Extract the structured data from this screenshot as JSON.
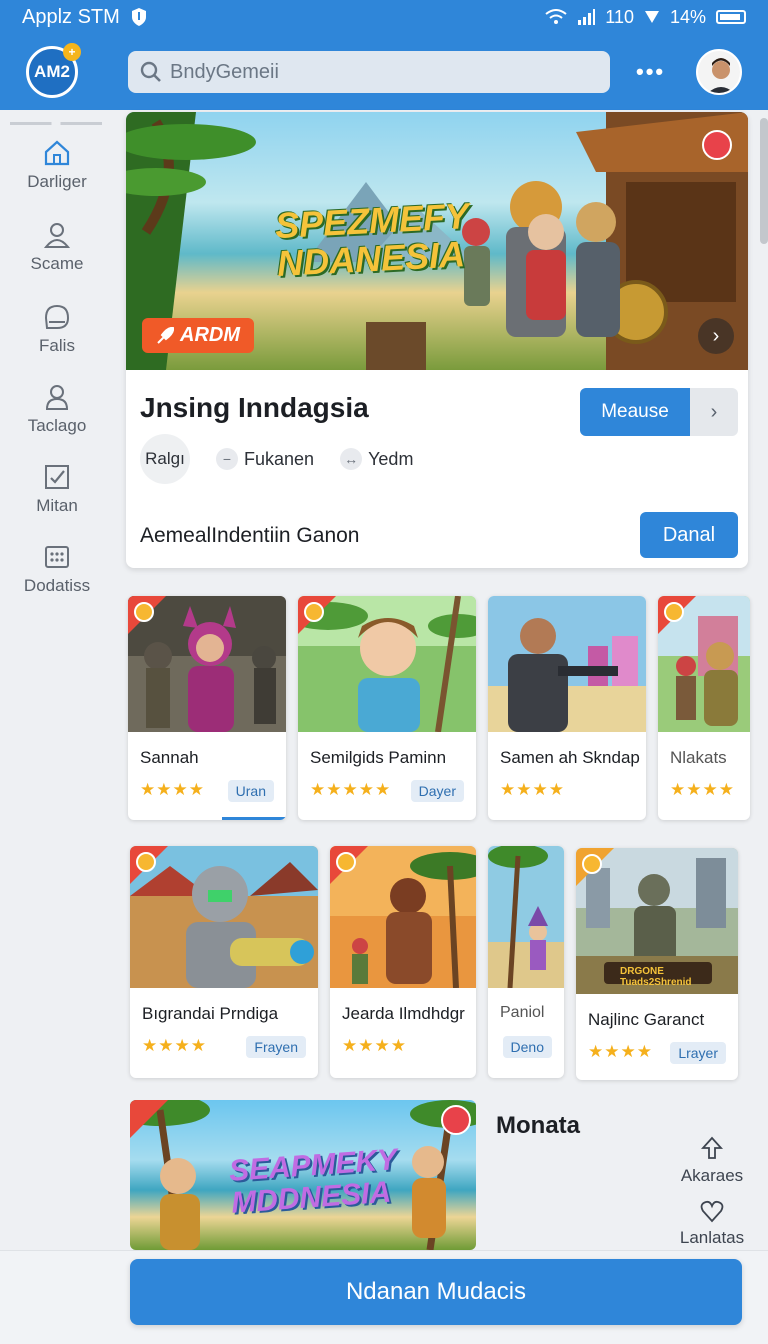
{
  "status_bar": {
    "app_name": "Applz STM",
    "network": "110",
    "battery_text": "14%"
  },
  "header": {
    "logo_text": "AM2",
    "search_placeholder": "BndyGemeii",
    "more_label": "•••"
  },
  "sidebar": {
    "items": [
      {
        "label": "Darliger",
        "icon": "home-icon"
      },
      {
        "label": "Scame",
        "icon": "user-icon"
      },
      {
        "label": "Falis",
        "icon": "chat-icon"
      },
      {
        "label": "Taclago",
        "icon": "person-icon"
      },
      {
        "label": "Mitan",
        "icon": "checkbox-icon"
      },
      {
        "label": "Dodatiss",
        "icon": "grid-icon"
      }
    ]
  },
  "hero": {
    "art_title_line1": "SPEZMEFY",
    "art_title_line2": "NDANESIA",
    "tag": "ARDM",
    "name": "Jnsing Inndagsia",
    "primary_button": "Meause",
    "chip_main": "Ralgı",
    "chip_1": "Fukanen",
    "chip_2": "Yedm",
    "subtitle": "AemealIndentiin Ganon",
    "secondary_button": "Danal"
  },
  "games_row1": [
    {
      "title": "Sannah",
      "pill": "Uran",
      "stars": "★★★★"
    },
    {
      "title": "Semilgids Paminn",
      "pill": "Dayer",
      "stars": "★★★★★"
    },
    {
      "title": "Samen ah Skndap",
      "pill": "",
      "stars": "★★★★"
    },
    {
      "title": "Nlakats",
      "pill": "",
      "stars": "★★★★"
    }
  ],
  "games_row2": [
    {
      "title": "Bıgrandai Prndiga",
      "pill": "Frayen",
      "stars": "★★★★"
    },
    {
      "title": "Jearda Ilmdhdgr",
      "pill": "",
      "stars": "★★★★"
    },
    {
      "title": "Paniol",
      "pill": "Deno",
      "stars": ""
    },
    {
      "title": "Najlinc Garanct",
      "pill": "Lrayer",
      "stars": "★★★★",
      "art_text": "DRGONE Tuads2Shrenid"
    }
  ],
  "promo": {
    "art_title_line1": "SEAPMEKY",
    "art_title_line2": "MDDNESIA"
  },
  "monata": {
    "title": "Monata",
    "action_1": "Akaraes",
    "action_2": "Lanlatas"
  },
  "cta": {
    "label": "Ndanan Mudacis"
  },
  "colors": {
    "primary": "#2f86d9",
    "accent": "#f05a28",
    "star": "#f5b01c"
  }
}
